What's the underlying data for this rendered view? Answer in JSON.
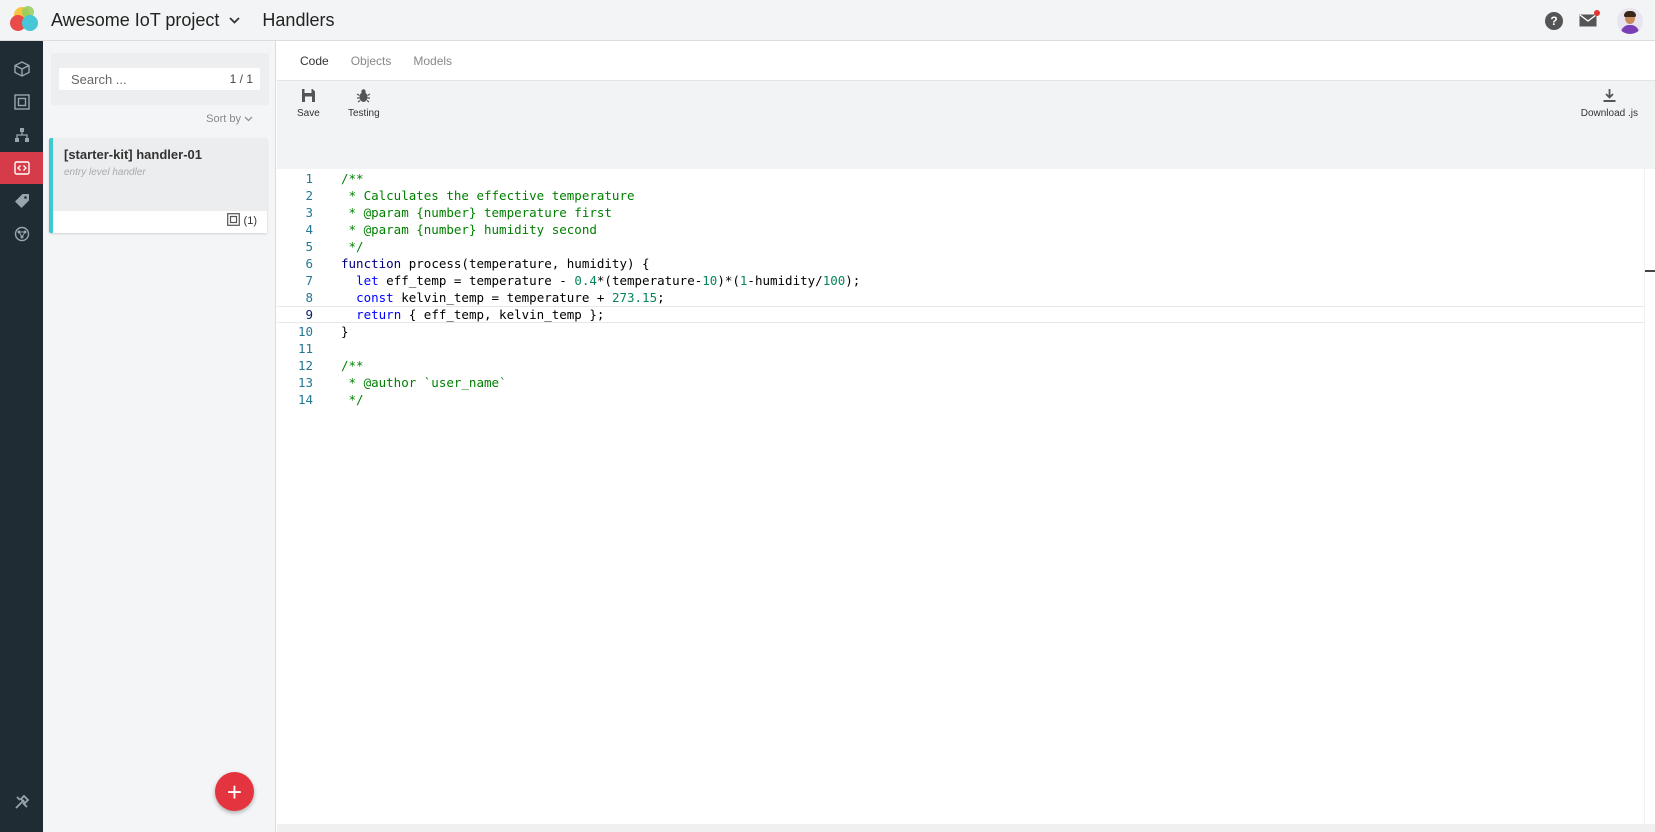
{
  "header": {
    "project_name": "Awesome IoT project",
    "section_title": "Handlers",
    "help_glyph": "?"
  },
  "rail": {
    "items": [
      "devices-icon",
      "objects-icon",
      "hierarchy-icon",
      "handlers-icon",
      "tags-icon",
      "network-icon"
    ],
    "active": "handlers-icon",
    "bottom": "tools-icon"
  },
  "list": {
    "search_placeholder": "Search ...",
    "search_count": "1 / 1",
    "sort_label": "Sort by",
    "items": [
      {
        "title": "[starter-kit] handler-01",
        "subtitle": "entry level handler",
        "badge": "(1)"
      }
    ],
    "add_glyph": "+"
  },
  "tabs": [
    "Code",
    "Objects",
    "Models"
  ],
  "active_tab": "Code",
  "toolbar": {
    "save": "Save",
    "testing": "Testing",
    "download": "Download .js"
  },
  "editor": {
    "line_numbers": [
      "1",
      "2",
      "3",
      "4",
      "5",
      "6",
      "7",
      "8",
      "9",
      "10",
      "11",
      "12",
      "13",
      "14"
    ],
    "current_line": "9",
    "lines": [
      "/**",
      " * Calculates the effective temperature",
      " * @param {number} temperature first",
      " * @param {number} humidity second",
      " */",
      "function process(temperature, humidity) {",
      "  let eff_temp = temperature - 0.4*(temperature-10)*(1-humidity/100);",
      "  const kelvin_temp = temperature + 273.15;",
      "  return { eff_temp, kelvin_temp };",
      "}",
      "",
      "/**",
      " * @author `user_name`",
      " */"
    ]
  },
  "colors": {
    "rail_bg": "#1f2c34",
    "rail_active": "#d63b4a",
    "card_accent": "#3ec9d0",
    "fab": "#e3343f",
    "comment": "#008000",
    "number": "#098658"
  }
}
